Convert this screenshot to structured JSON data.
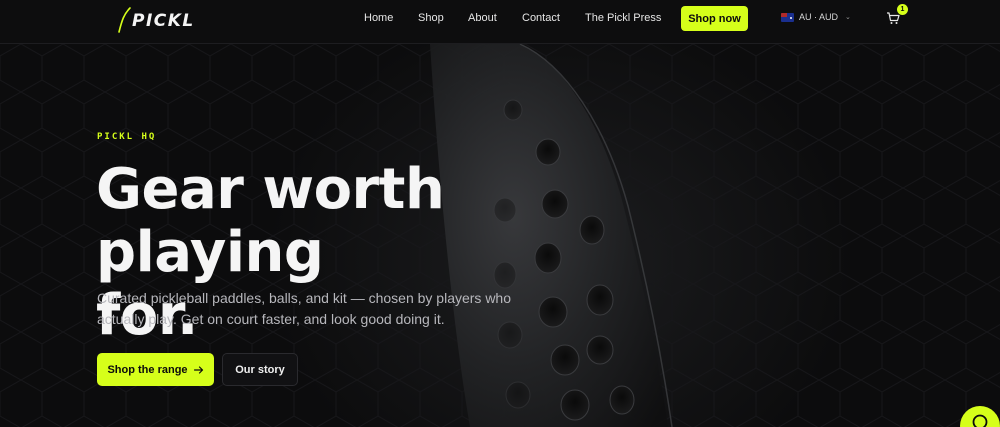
{
  "brand": {
    "name": "PICKL",
    "accent": "#d6ff1a",
    "background": "#0b0b0c"
  },
  "nav": {
    "items": [
      "Home",
      "Shop",
      "About",
      "Contact",
      "The Pickl Press"
    ],
    "cta_label": "Shop now",
    "locale_label": "AU · AUD",
    "locale_flag": "australia-flag-icon",
    "cart_count": "1",
    "cart_icon": "cart-icon"
  },
  "hero": {
    "eyebrow": "PICKL HQ",
    "headline_line1": "Gear worth playing",
    "headline_line2": "for.",
    "subtext": "Curated pickleball paddles, balls, and kit — chosen by players who actually play. Get on court faster, and look good doing it.",
    "primary_cta": "Shop the range",
    "primary_cta_icon": "arrow-right-icon",
    "secondary_cta": "Our story",
    "background_image": "pickleball-paddle-image"
  },
  "chat": {
    "icon": "chat-icon"
  }
}
